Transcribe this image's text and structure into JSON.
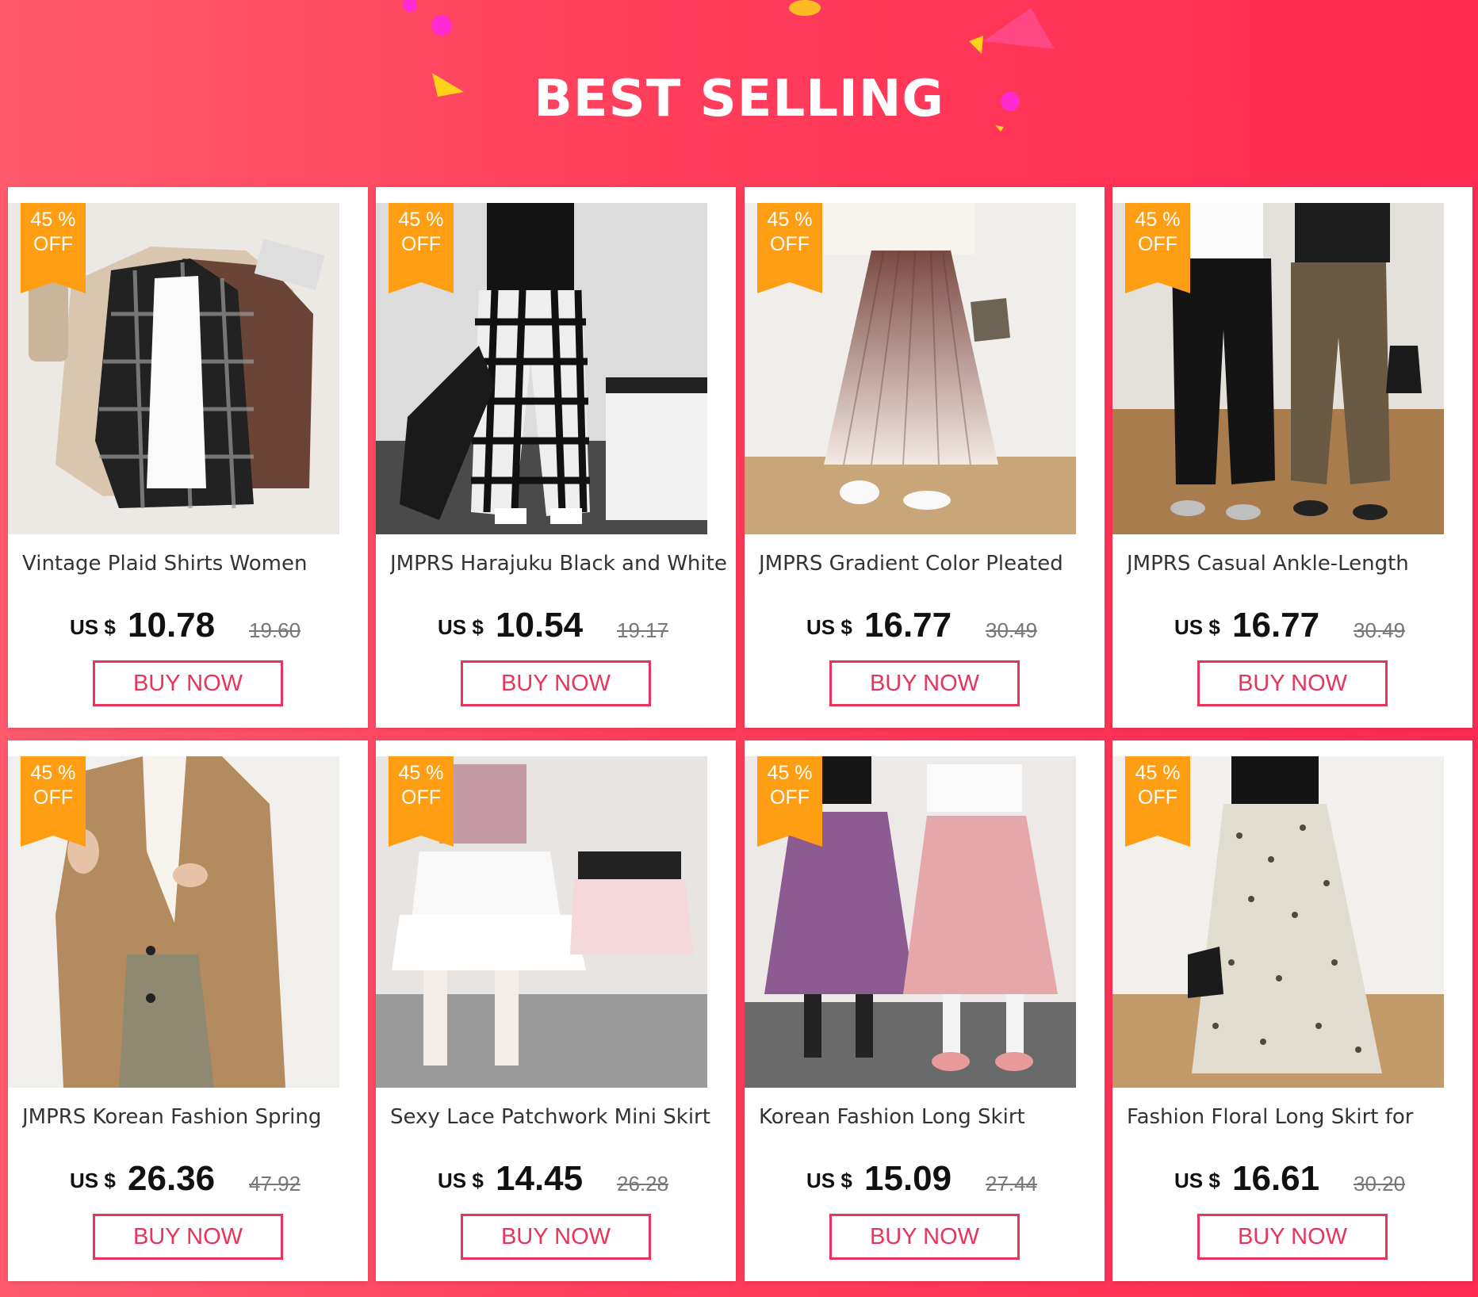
{
  "header": {
    "title": "BEST SELLING"
  },
  "buy_label": "BUY NOW",
  "currency": "US $",
  "products": [
    {
      "name": "Vintage Plaid Shirts Women",
      "discount_pct": "45 %",
      "discount_off": "OFF",
      "price": "10.78",
      "old_price": "19.60"
    },
    {
      "name": "JMPRS Harajuku Black and White",
      "discount_pct": "45 %",
      "discount_off": "OFF",
      "price": "10.54",
      "old_price": "19.17"
    },
    {
      "name": "JMPRS Gradient Color Pleated",
      "discount_pct": "45 %",
      "discount_off": "OFF",
      "price": "16.77",
      "old_price": "30.49"
    },
    {
      "name": "JMPRS Casual Ankle-Length",
      "discount_pct": "45 %",
      "discount_off": "OFF",
      "price": "16.77",
      "old_price": "30.49"
    },
    {
      "name": "JMPRS Korean Fashion Spring",
      "discount_pct": "45 %",
      "discount_off": "OFF",
      "price": "26.36",
      "old_price": "47.92"
    },
    {
      "name": "Sexy Lace Patchwork Mini Skirt",
      "discount_pct": "45 %",
      "discount_off": "OFF",
      "price": "14.45",
      "old_price": "26.28"
    },
    {
      "name": "Korean Fashion Long Skirt",
      "discount_pct": "45 %",
      "discount_off": "OFF",
      "price": "15.09",
      "old_price": "27.44"
    },
    {
      "name": "Fashion Floral Long Skirt for",
      "discount_pct": "45 %",
      "discount_off": "OFF",
      "price": "16.61",
      "old_price": "30.20"
    }
  ],
  "colors": {
    "accent": "#e8335a",
    "badge": "#ff9e12",
    "background": "#ff3d5b"
  }
}
